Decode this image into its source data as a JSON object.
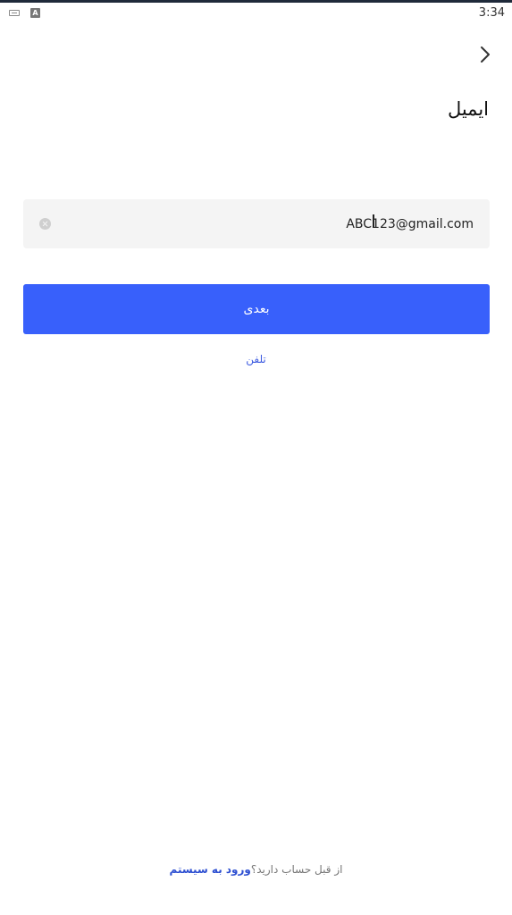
{
  "status_bar": {
    "time": "3:34",
    "icons": [
      "keyboard-icon",
      "a-app-icon"
    ]
  },
  "header": {
    "back_icon": "chevron-right-icon",
    "title": "ایمیل"
  },
  "email_field": {
    "value": "ABC123@gmail.com",
    "clear_icon": "clear-circle-icon"
  },
  "next_button": {
    "label": "بعدی"
  },
  "alt_method": {
    "label": "تلفن"
  },
  "footer": {
    "prompt": "از قبل حساب دارید؟",
    "login_label": "ورود به سیستم"
  },
  "colors": {
    "primary": "#3860fb",
    "link": "#3d5be0",
    "input_bg": "#f4f4f4"
  }
}
